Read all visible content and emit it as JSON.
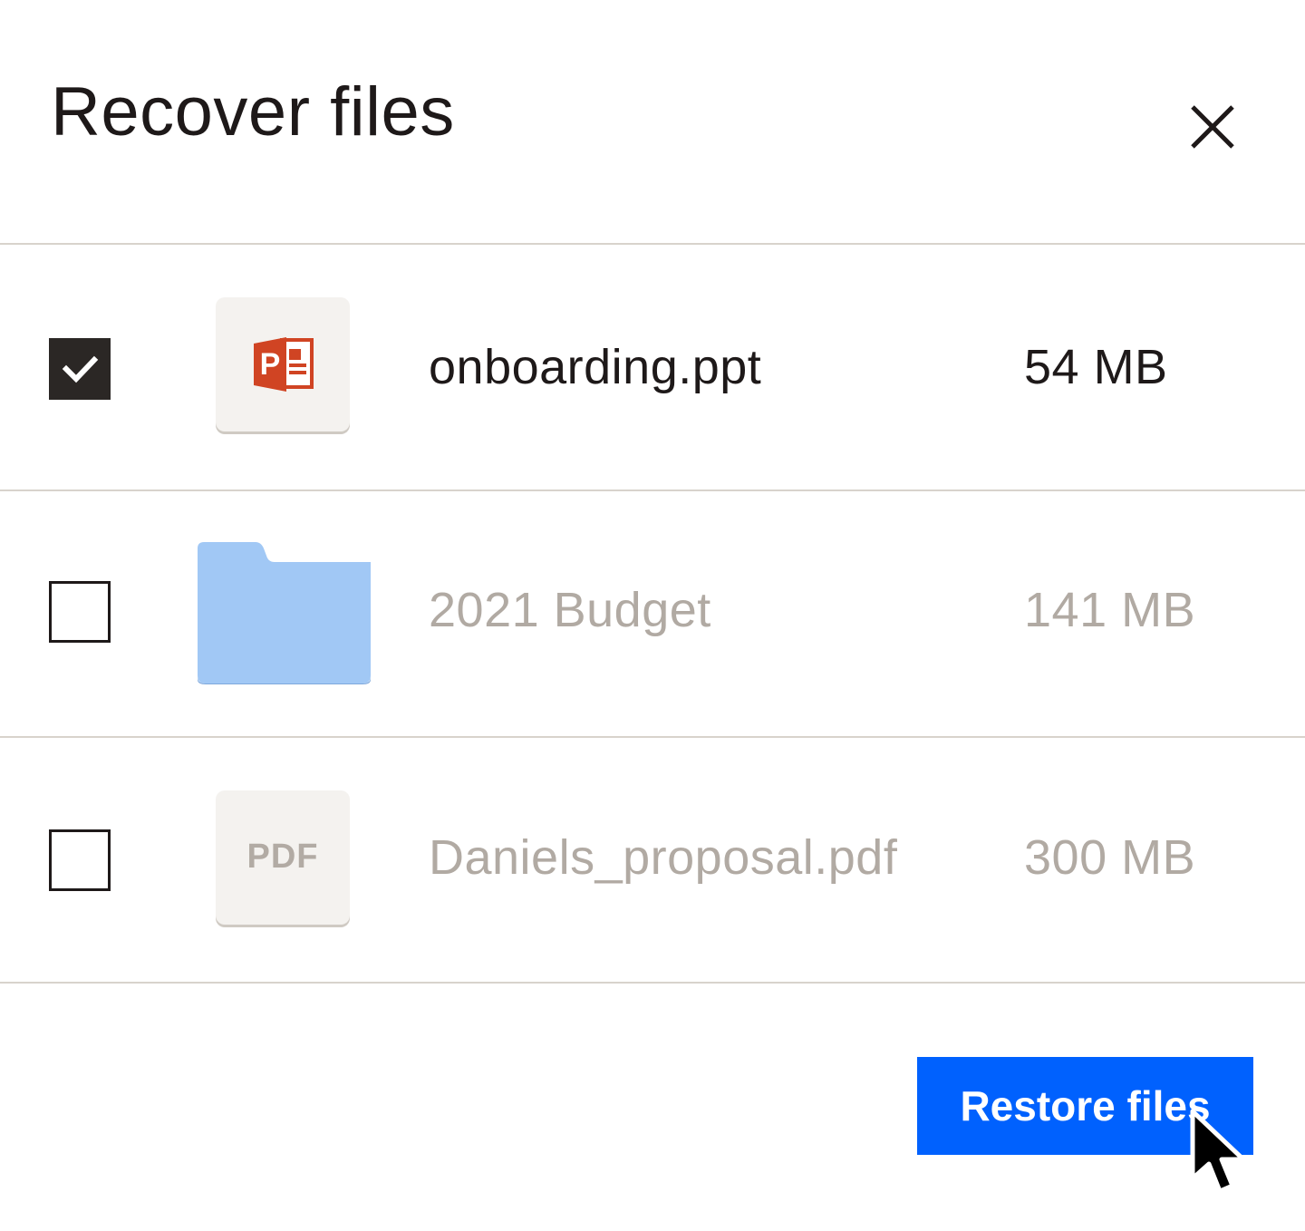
{
  "dialog": {
    "title": "Recover files",
    "close_icon": "close-icon"
  },
  "files": [
    {
      "name": "onboarding.ppt",
      "size": "54 MB",
      "type_icon": "powerpoint-icon",
      "checked": true
    },
    {
      "name": "2021 Budget",
      "size": "141 MB",
      "type_icon": "folder-icon",
      "checked": false
    },
    {
      "name": "Daniels_proposal.pdf",
      "size": "300 MB",
      "type_icon": "pdf-icon",
      "type_label": "PDF",
      "checked": false
    }
  ],
  "footer": {
    "restore_label": "Restore files"
  },
  "colors": {
    "primary_button": "#0061fe",
    "checkbox_checked": "#2b2725",
    "folder": "#a1c8f5",
    "powerpoint": "#d04423",
    "muted_text": "#b1aaa3",
    "divider": "#d8d3cc"
  }
}
